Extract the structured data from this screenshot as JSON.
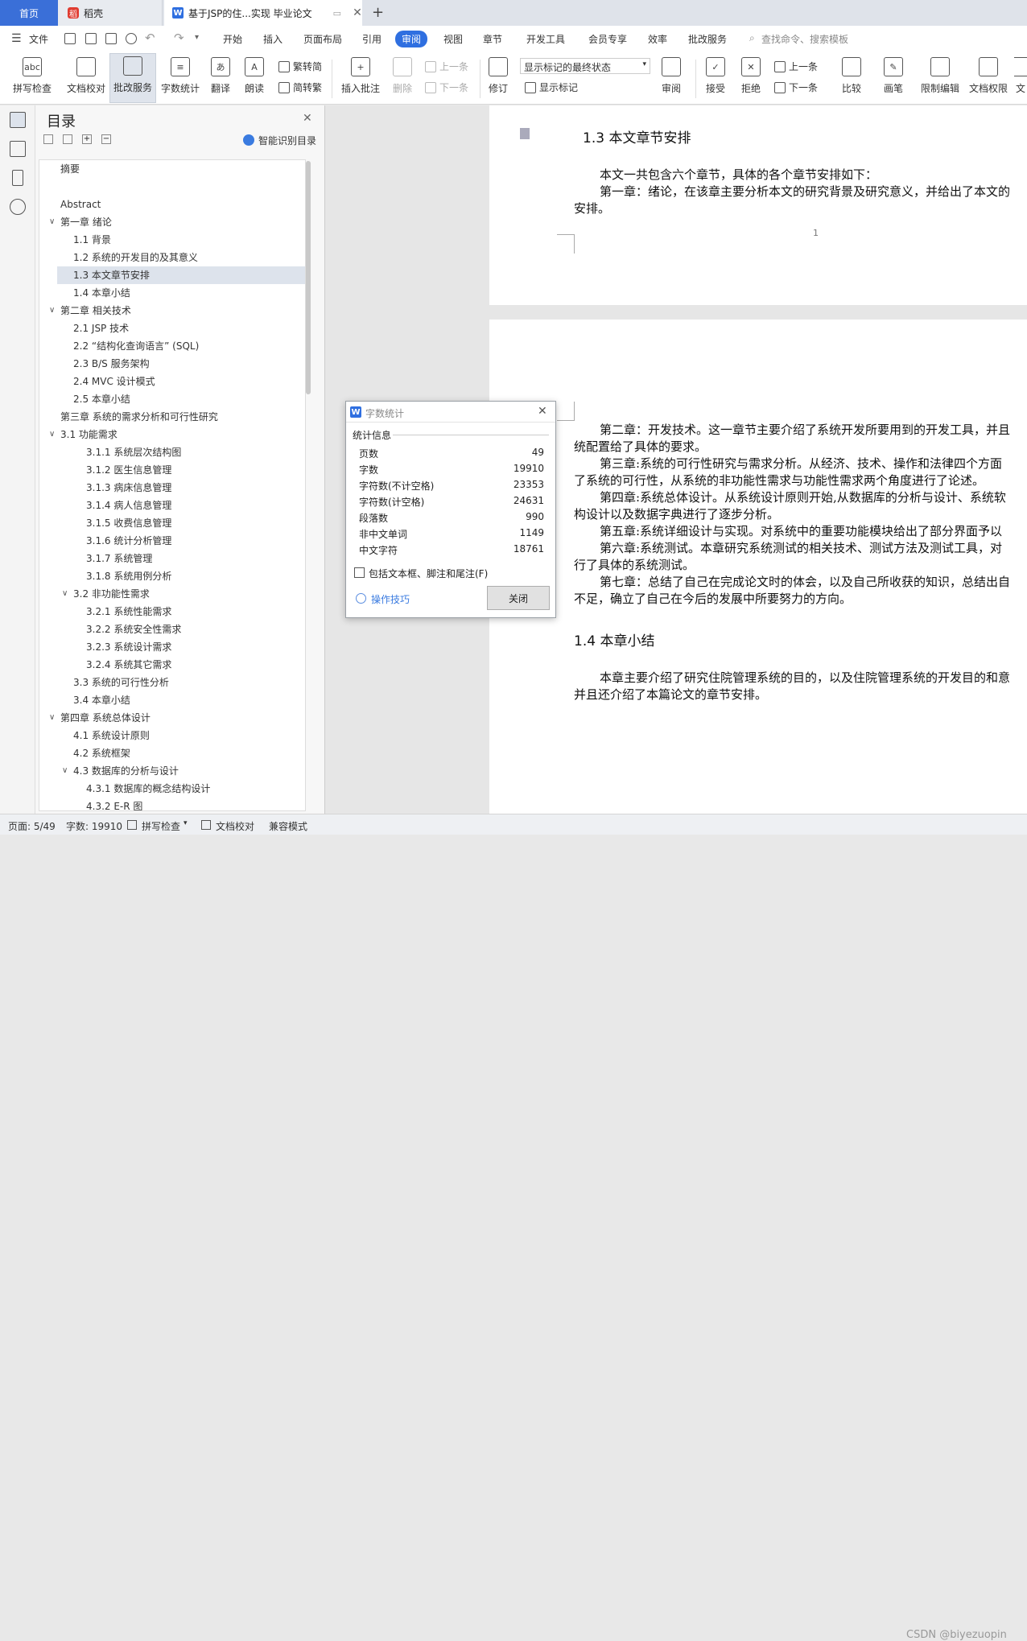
{
  "tabs": {
    "home": "首页",
    "daoke": "稻壳",
    "doc": "基于JSP的住...实现 毕业论文"
  },
  "menubar": {
    "file": "文件",
    "items": [
      "开始",
      "插入",
      "页面布局",
      "引用",
      "审阅",
      "视图",
      "章节",
      "开发工具",
      "会员专享",
      "效率",
      "批改服务"
    ],
    "active": "审阅",
    "search_placeholder": "查找命令、搜索模板"
  },
  "ribbon": {
    "spellcheck": "拼写检查",
    "doc_check": "文档校对",
    "review_service": "批改服务",
    "word_count": "字数统计",
    "translate": "翻译",
    "read_aloud": "朗读",
    "trad": "繁转简",
    "simp": "简转繁",
    "insert_comment": "插入批注",
    "delete": "删除",
    "prev": "上一条",
    "next": "下一条",
    "track": "修订",
    "markup_state": "显示标记的最终状态",
    "show_markup": "显示标记",
    "review_pane": "审阅",
    "accept": "接受",
    "reject": "拒绝",
    "prev2": "上一条",
    "next2": "下一条",
    "compare": "比较",
    "pen": "画笔",
    "restrict": "限制编辑",
    "doc_permission": "文档权限",
    "more": "文"
  },
  "nav": {
    "title": "目录",
    "smart": "智能识别目录",
    "items": [
      {
        "t": "摘要",
        "lvl": 0
      },
      {
        "t": "Abstract",
        "lvl": 0
      },
      {
        "t": "第一章   绪论",
        "lvl": 0,
        "chev": "v"
      },
      {
        "t": "1.1   背景",
        "lvl": 1
      },
      {
        "t": "1.2   系统的开发目的及其意义",
        "lvl": 1
      },
      {
        "t": "1.3   本文章节安排",
        "lvl": 1,
        "sel": true
      },
      {
        "t": "1.4   本章小结",
        "lvl": 1
      },
      {
        "t": "第二章   相关技术",
        "lvl": 0,
        "chev": "v"
      },
      {
        "t": "2.1   JSP 技术",
        "lvl": 1
      },
      {
        "t": "2.2   “结构化查询语言” (SQL)",
        "lvl": 1
      },
      {
        "t": "2.3   B/S 服务架构",
        "lvl": 1
      },
      {
        "t": "2.4   MVC 设计模式",
        "lvl": 1
      },
      {
        "t": "2.5   本章小结",
        "lvl": 1
      },
      {
        "t": "第三章  系统的需求分析和可行性研究",
        "lvl": 0
      },
      {
        "t": "3.1   功能需求",
        "lvl": 0,
        "chev": "v"
      },
      {
        "t": "3.1.1   系统层次结构图",
        "lvl": 2
      },
      {
        "t": "3.1.2   医生信息管理",
        "lvl": 2
      },
      {
        "t": "3.1.3   病床信息管理",
        "lvl": 2
      },
      {
        "t": "3.1.4   病人信息管理",
        "lvl": 2
      },
      {
        "t": "3.1.5   收费信息管理",
        "lvl": 2
      },
      {
        "t": "3.1.6   统计分析管理",
        "lvl": 2
      },
      {
        "t": "3.1.7   系统管理",
        "lvl": 2
      },
      {
        "t": "3.1.8   系统用例分析",
        "lvl": 2
      },
      {
        "t": "3.2   非功能性需求",
        "lvl": 1,
        "chev": "v"
      },
      {
        "t": "3.2.1   系统性能需求",
        "lvl": 2
      },
      {
        "t": "3.2.2   系统安全性需求",
        "lvl": 2
      },
      {
        "t": "3.2.3   系统设计需求",
        "lvl": 2
      },
      {
        "t": "3.2.4   系统其它需求",
        "lvl": 2
      },
      {
        "t": "3.3   系统的可行性分析",
        "lvl": 1
      },
      {
        "t": "3.4   本章小结",
        "lvl": 1
      },
      {
        "t": "第四章   系统总体设计",
        "lvl": 0,
        "chev": "v"
      },
      {
        "t": "4.1   系统设计原则",
        "lvl": 1
      },
      {
        "t": "4.2   系统框架",
        "lvl": 1
      },
      {
        "t": "4.3   数据库的分析与设计",
        "lvl": 1,
        "chev": "v"
      },
      {
        "t": "4.3.1   数据库的概念结构设计",
        "lvl": 2
      },
      {
        "t": "4.3.2   E-R 图",
        "lvl": 2
      }
    ]
  },
  "doc": {
    "heading13": "1.3   本文章节安排",
    "p1": "本文一共包含六个章节，具体的各个章节安排如下：",
    "p2a": "第一章：绪论，在该章主要分析本文的研究背景及研究意义，并给出了本文的",
    "p2b": "安排。",
    "page_no": "1",
    "l1": "第二章：开发技术。这一章节主要介绍了系统开发所要用到的开发工具，并且",
    "l2": "统配置给了具体的要求。",
    "l3": "第三章:系统的可行性研究与需求分析。从经济、技术、操作和法律四个方面",
    "l4": "了系统的可行性，从系统的非功能性需求与功能性需求两个角度进行了论述。",
    "l5": "第四章:系统总体设计。从系统设计原则开始,从数据库的分析与设计、系统软",
    "l6": "构设计以及数据字典进行了逐步分析。",
    "l7": "第五章:系统详细设计与实现。对系统中的重要功能模块给出了部分界面予以",
    "l8": "第六章:系统测试。本章研究系统测试的相关技术、测试方法及测试工具，对",
    "l9": "行了具体的系统测试。",
    "l10": "第七章：总结了自己在完成论文时的体会，以及自己所收获的知识，总结出自",
    "l11": "不足，确立了自己在今后的发展中所要努力的方向。",
    "heading14": "1.4   本章小结",
    "s1": "本章主要介绍了研究住院管理系统的目的，以及住院管理系统的开发目的和意",
    "s2": "并且还介绍了本篇论文的章节安排。"
  },
  "dialog": {
    "title": "字数统计",
    "section": "统计信息",
    "rows": [
      {
        "k": "页数",
        "v": "49"
      },
      {
        "k": "字数",
        "v": "19910"
      },
      {
        "k": "字符数(不计空格)",
        "v": "23353"
      },
      {
        "k": "字符数(计空格)",
        "v": "24631"
      },
      {
        "k": "段落数",
        "v": "990"
      },
      {
        "k": "非中文单词",
        "v": "1149"
      },
      {
        "k": "中文字符",
        "v": "18761"
      }
    ],
    "checkbox": "包括文本框、脚注和尾注(F)",
    "tips": "操作技巧",
    "close": "关闭"
  },
  "status": {
    "page": "页面: 5/49",
    "words": "字数: 19910",
    "spell": "拼写检查",
    "check": "文档校对",
    "compat": "兼容模式",
    "watermark": "CSDN @biyezuopin"
  }
}
